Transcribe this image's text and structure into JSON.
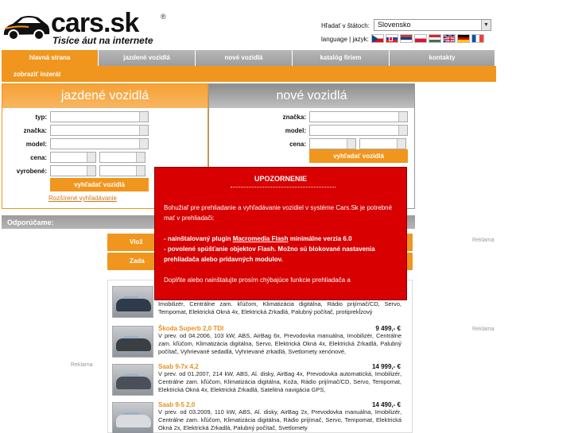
{
  "header": {
    "logo_text": "cars.sk",
    "logo_registered": "®",
    "tagline": "Tisíce áut na internete",
    "search_label": "Hľadať v štátoch:",
    "country_value": "Slovensko",
    "lang_label": "language | jazyk:",
    "flags": [
      "cz-flag-icon",
      "sk-flag-icon",
      "rs-flag-icon",
      "pl-flag-icon",
      "hu-flag-icon",
      "gb-flag-icon",
      "de-flag-icon",
      "fr-flag-icon"
    ]
  },
  "nav": {
    "tabs": [
      "hlavná strana",
      "jazdené vozidlá",
      "nové vozidlá",
      "katalóg firiem",
      "kontakty"
    ],
    "subnav_link": "zobraziť inzerát"
  },
  "used_panel": {
    "title": "jazdené vozidlá",
    "labels": [
      "typ:",
      "značka:",
      "model:",
      "cena:",
      "vyrobené:"
    ],
    "button": "vyhľadať vozidlá",
    "advanced_link": "Rozšírené vyhľadávanie"
  },
  "new_panel": {
    "title": "nové vozidlá",
    "labels": [
      "značka:",
      "model:",
      "cena:"
    ],
    "button": "vyhľadať vozidlá"
  },
  "recommend": {
    "label": "Odporúčame:",
    "promo1": "Vlož",
    "promo2": "Zada"
  },
  "listings": [
    {
      "title": "",
      "price": "",
      "desc": "Imobilizér, Centrálne zam. kľúčom, Klimatizácia digitálna, Rádio prijímač/CD, Servo, Tempomat, Elektrická Okná 4x, Elektrická Zrkadlá, Palubný počítač, protiprekĺzový"
    },
    {
      "title": "Škoda Superb 2,0 TDI",
      "price": "9 499,- €",
      "desc": "V prev. od 04.2006, 103 kW, ABS, AirBag 6x, Prevodovka manuálna, Imobilizér, Centrálne zam. kľúčom, Klimatizácia digitálna, Servo, Elektrická Okná 4x, Elektrická Zrkadlá, Palubný počítač, Vyhrievané sedadlá, Vyhrievané zrkadlá, Svetlomety xenónové,"
    },
    {
      "title": "Saab 9-7x 4,2",
      "price": "14 999,- €",
      "desc": "V prev. od 01.2007, 214 kW, ABS, Al. disky, AirBag 4x, Prevodovka automatická, Imobilizér, Centrálne zam. kľúčom, Klimatizácia digitálna, Koža, Rádio prijímač/CD, Servo, Tempomat, Elektrická Okná 4x, Elektrická Zrkadlá, Satelitná navigácia GPS,"
    },
    {
      "title": "Saab 9-5 2,0",
      "price": "14 490,- €",
      "desc": "V prev. od 03.2009, 110 kW, ABS, Al. disky, AirBag 2x, Prevodovka manuálna, Imobilizér, Centrálne zam. kľúčom, Klimatizácia digitálna, Rádio prijímač, Servo, Tempomat, Elektrická Okná 2x, Elektrická Zrkadlá, Palubný počítač, Svetlomety"
    }
  ],
  "ads": {
    "label": "Reklama"
  },
  "modal": {
    "title": "UPOZORNENIE",
    "intro": "Bohužiaľ pre prehliadanie a vyhľadávanie vozidiel v systéme Cars.Sk je potrebné mať v prehliadači:",
    "req1_prefix": "- nainštalovaný plugin ",
    "req1_link": "Macromedia Flash",
    "req1_suffix": " minimálne verzia 6.0",
    "req2": "- povolené spúšťanie objektov Flash. Možno sú blokované nastavenia prehliadača alebo prídavných modulov.",
    "outro": "Doplňte alebo nainštalujte prosím chýbajúce funkcie prehliadača a"
  },
  "colors": {
    "orange": "#f0961e",
    "red_modal": "#d80000",
    "gray_tab": "#a8a8a8"
  }
}
